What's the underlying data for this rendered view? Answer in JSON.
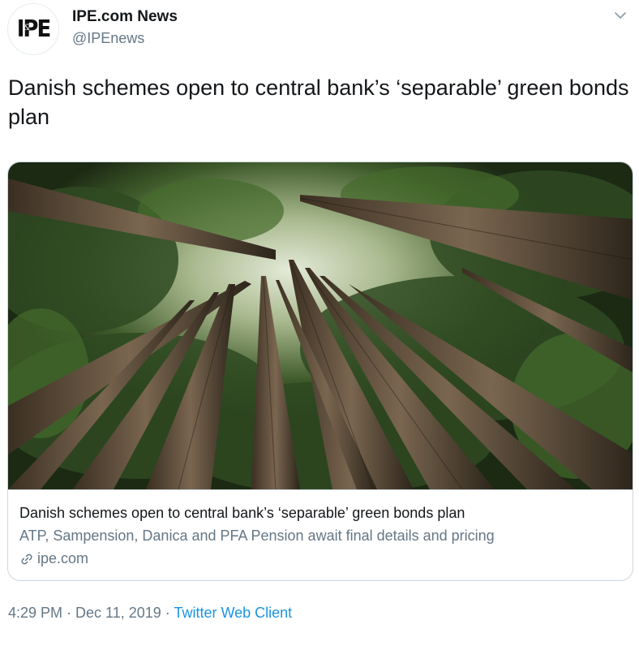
{
  "author": {
    "avatar_logo": "IPE",
    "avatar_logo_sub": "&",
    "display_name": "IPE.com News",
    "handle": "@IPEnews"
  },
  "tweet": {
    "text": "Danish schemes open to central bank’s ‘separable’ green bonds plan"
  },
  "card": {
    "title": "Danish schemes open to central bank’s ‘separable’ green bonds plan",
    "description": "ATP, Sampension, Danica and PFA Pension await final details and pricing",
    "domain": "ipe.com",
    "image_icon": "forest-canopy-photo"
  },
  "meta": {
    "time": "4:29 PM",
    "separator1": " · ",
    "date": "Dec 11, 2019",
    "separator2": " · ",
    "client": "Twitter Web Client"
  },
  "icons": {
    "menu": "chevron-down-icon",
    "link": "link-icon"
  },
  "colors": {
    "text_primary": "#14171a",
    "text_secondary": "#657786",
    "link_blue": "#1b95e0",
    "border": "#ccd6dd"
  }
}
